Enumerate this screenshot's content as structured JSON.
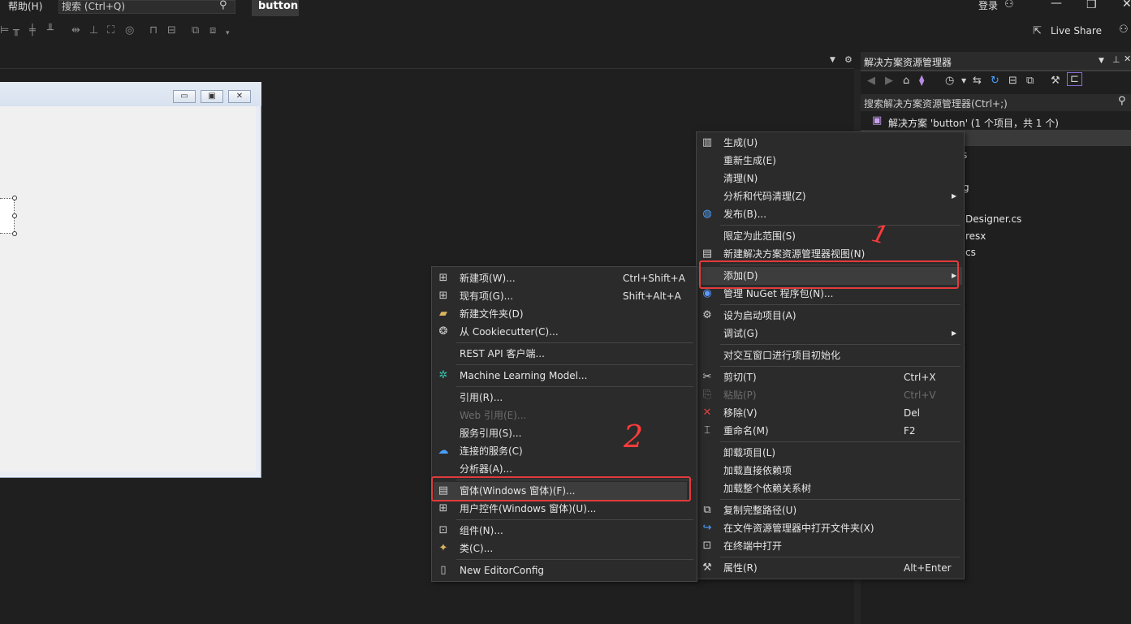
{
  "menubar": {
    "help": "帮助(H)",
    "search_label": "搜索 (Ctrl+Q)",
    "project": "button",
    "signin": "登录"
  },
  "toolbar": {
    "liveshare": "Live Share"
  },
  "solution_explorer": {
    "title": "解决方案资源管理器",
    "search_placeholder": "搜索解决方案资源管理器(Ctrl+;)",
    "solution_label": "解决方案 'button' (1 个项目，共 1 个)",
    "items": [
      "s",
      "g",
      "Designer.cs",
      "resx",
      "cs"
    ]
  },
  "context_menu": {
    "items": [
      {
        "label": "生成(U)",
        "icon": "build-icon"
      },
      {
        "label": "重新生成(E)"
      },
      {
        "label": "清理(N)"
      },
      {
        "label": "分析和代码清理(Z)",
        "submenu": true
      },
      {
        "label": "发布(B)...",
        "icon": "globe-icon"
      },
      {
        "label": "限定为此范围(S)"
      },
      {
        "label": "新建解决方案资源管理器视图(N)",
        "icon": "new-view-icon"
      },
      {
        "label": "添加(D)",
        "submenu": true,
        "highlighted": true
      },
      {
        "label": "管理 NuGet 程序包(N)...",
        "icon": "nuget-icon"
      },
      {
        "label": "设为启动项目(A)",
        "icon": "gear-icon"
      },
      {
        "label": "调试(G)",
        "submenu": true
      },
      {
        "label": "对交互窗口进行项目初始化"
      },
      {
        "label": "剪切(T)",
        "shortcut": "Ctrl+X",
        "icon": "cut-icon"
      },
      {
        "label": "粘贴(P)",
        "shortcut": "Ctrl+V",
        "disabled": true,
        "icon": "paste-icon"
      },
      {
        "label": "移除(V)",
        "shortcut": "Del",
        "icon": "remove-icon"
      },
      {
        "label": "重命名(M)",
        "shortcut": "F2",
        "icon": "rename-icon"
      },
      {
        "label": "卸载项目(L)"
      },
      {
        "label": "加载直接依赖项"
      },
      {
        "label": "加载整个依赖关系树"
      },
      {
        "label": "复制完整路径(U)",
        "icon": "copy-icon"
      },
      {
        "label": "在文件资源管理器中打开文件夹(X)",
        "icon": "open-folder-icon"
      },
      {
        "label": "在终端中打开",
        "icon": "terminal-icon"
      },
      {
        "label": "属性(R)",
        "shortcut": "Alt+Enter",
        "icon": "wrench-icon"
      }
    ]
  },
  "add_submenu": {
    "items": [
      {
        "label": "新建项(W)...",
        "shortcut": "Ctrl+Shift+A",
        "icon": "new-item-icon"
      },
      {
        "label": "现有项(G)...",
        "shortcut": "Shift+Alt+A",
        "icon": "existing-item-icon"
      },
      {
        "label": "新建文件夹(D)",
        "icon": "new-folder-icon"
      },
      {
        "label": "从 Cookiecutter(C)...",
        "icon": "cookiecutter-icon"
      },
      {
        "label": "REST API 客户端..."
      },
      {
        "label": "Machine Learning Model...",
        "icon": "ml-icon"
      },
      {
        "label": "引用(R)..."
      },
      {
        "label": "Web 引用(E)...",
        "disabled": true
      },
      {
        "label": "服务引用(S)..."
      },
      {
        "label": "连接的服务(C)",
        "icon": "connected-service-icon"
      },
      {
        "label": "分析器(A)..."
      },
      {
        "label": "窗体(Windows 窗体)(F)...",
        "icon": "form-icon",
        "highlighted": true
      },
      {
        "label": "用户控件(Windows 窗体)(U)...",
        "icon": "user-control-icon"
      },
      {
        "label": "组件(N)...",
        "icon": "component-icon"
      },
      {
        "label": "类(C)...",
        "icon": "class-icon"
      },
      {
        "label": "New EditorConfig",
        "icon": "file-icon"
      }
    ]
  },
  "annotations": {
    "step1": "1",
    "step2": "2"
  },
  "colors": {
    "background": "#1f1f1f",
    "menu_bg": "#2b2b2b",
    "annotation_red": "#e23b3b"
  }
}
